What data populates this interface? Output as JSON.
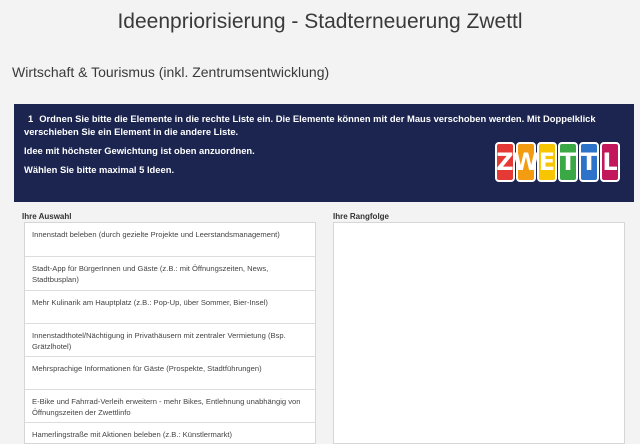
{
  "page": {
    "title": "Ideenpriorisierung - Stadterneuerung Zwettl",
    "section": "Wirtschaft & Tourismus (inkl. Zentrumsentwicklung)"
  },
  "question": {
    "number": "1",
    "instruction": "Ordnen Sie bitte die Elemente in die rechte Liste ein. Die Elemente können mit der Maus verschoben werden. Mit Doppelklick verschieben Sie ein Element in die andere Liste.",
    "weighting": "Idee mit höchster Gewichtung ist oben anzuordnen.",
    "limit": "Wählen Sie bitte maximal 5 Ideen.",
    "banner_color": "#1b2550"
  },
  "logo": {
    "letters": [
      {
        "char": "Z",
        "color": "#e53935"
      },
      {
        "char": "W",
        "color": "#f39c12"
      },
      {
        "char": "E",
        "color": "#f7c600"
      },
      {
        "char": "T",
        "color": "#3aa845"
      },
      {
        "char": "T",
        "color": "#2c73c9"
      },
      {
        "char": "L",
        "color": "#c2185b"
      }
    ]
  },
  "lists": {
    "available_label": "Ihre Auswahl",
    "ranking_label": "Ihre Rangfolge",
    "available_items": [
      "Innenstadt beleben (durch gezielte Projekte und Leerstandsmanagement)",
      "Stadt-App für BürgerInnen und Gäste (z.B.: mit Öffnungszeiten, News, Stadtbusplan)",
      "Mehr Kulinarik am Hauptplatz (z.B.: Pop-Up, über Sommer, Bier-Insel)",
      "Innenstadthotel/Nächtigung in Privathäusern mit zentraler Vermietung (Bsp. Grätzlhotel)",
      "Mehrsprachige Informationen für Gäste (Prospekte, Stadtführungen)",
      "E-Bike und Fahrrad-Verleih erweitern - mehr Bikes, Entlehnung unabhängig von Öffnungszeiten der Zwettlinfo",
      "Hamerlingstraße mit Aktionen beleben (z.B.: Künstlermarkt)"
    ],
    "ranking_items": []
  }
}
